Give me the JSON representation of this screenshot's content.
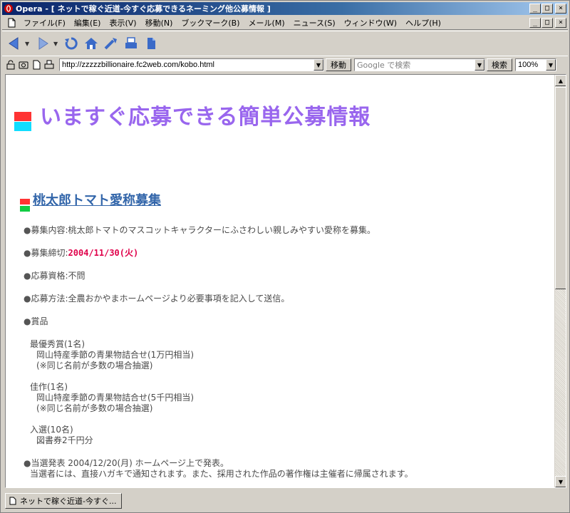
{
  "window": {
    "title": "Opera - [ ネットで稼ぐ近道-今すぐ応募できるネーミング他公募情報 ]",
    "min_glyph": "_",
    "max_glyph": "□",
    "close_glyph": "×"
  },
  "menu": {
    "items": [
      {
        "label": "ファイル(F)"
      },
      {
        "label": "編集(E)"
      },
      {
        "label": "表示(V)"
      },
      {
        "label": "移動(N)"
      },
      {
        "label": "ブックマーク(B)"
      },
      {
        "label": "メール(M)"
      },
      {
        "label": "ニュース(S)"
      },
      {
        "label": "ウィンドウ(W)"
      },
      {
        "label": "ヘルプ(H)"
      }
    ]
  },
  "addressbar": {
    "url": "http://zzzzzbillionaire.fc2web.com/kobo.html",
    "go_label": "移動",
    "search_placeholder": "Google で検索",
    "search_label": "検索",
    "zoom": "100%"
  },
  "page": {
    "main_title": "いますぐ応募できる簡単公募情報",
    "sub_title": "桃太郎トマト愛称募集",
    "bullet": "●",
    "content_label": "募集内容:",
    "content_value": "桃太郎トマトのマスコットキャラクターにふさわしい親しみやすい愛称を募集。",
    "deadline_label": "募集締切:",
    "deadline_value": "2004/11/30(火)",
    "eligibility_label": "応募資格:",
    "eligibility_value": "不問",
    "method_label": "応募方法:",
    "method_value": "全農おかやまホームページより必要事項を記入して送信。",
    "prize_label": "賞品",
    "prizes": [
      {
        "name": "最優秀賞(1名)",
        "item": "岡山特産季節の青果物詰合せ(1万円相当)",
        "note": "(※同じ名前が多数の場合抽選)"
      },
      {
        "name": "佳作(1名)",
        "item": "岡山特産季節の青果物詰合せ(5千円相当)",
        "note": "(※同じ名前が多数の場合抽選)"
      },
      {
        "name": "入選(10名)",
        "item": "図書券2千円分"
      }
    ],
    "announce": "当選発表 2004/12/20(月) ホームページ上で発表。",
    "announce_note": "当選者には、直接ハガキで通知されます。また、採用された作品の著作権は主催者に帰属されます。"
  },
  "status": {
    "tab_label": "ネットで稼ぐ近道-今すぐ..."
  },
  "colors": {
    "title_purple": "#9966ee",
    "link_blue": "#3366aa",
    "deadline_red": "#e0004a",
    "deco_red": "#ff3333",
    "deco_cyan": "#11ddff",
    "deco_green": "#11cc44"
  }
}
